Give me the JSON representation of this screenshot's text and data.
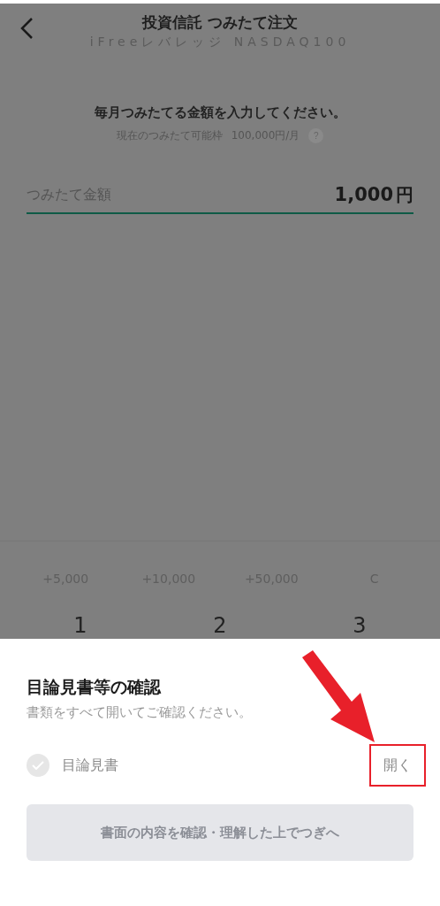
{
  "header": {
    "title": "投資信託 つみたて注文",
    "subtitle": "iFreeレバレッジ NASDAQ100"
  },
  "prompt": {
    "heading": "毎月つみたてる金額を入力してください。",
    "limit_label": "現在のつみたて可能枠",
    "limit_value": "100,000円/月",
    "help": "?"
  },
  "amount_field": {
    "label": "つみたて金額",
    "value": "1,000",
    "unit": "円"
  },
  "quick_add": [
    "+5,000",
    "+10,000",
    "+50,000",
    "C"
  ],
  "keypad": [
    "1",
    "2",
    "3"
  ],
  "sheet": {
    "title": "目論見書等の確認",
    "subtitle": "書類をすべて開いてご確認ください。",
    "documents": [
      {
        "name": "目論見書",
        "checked": false,
        "action": "開く",
        "highlighted": true
      }
    ],
    "next_button": {
      "label": "書面の内容を確認・理解した上でつぎへ",
      "disabled": true
    }
  }
}
